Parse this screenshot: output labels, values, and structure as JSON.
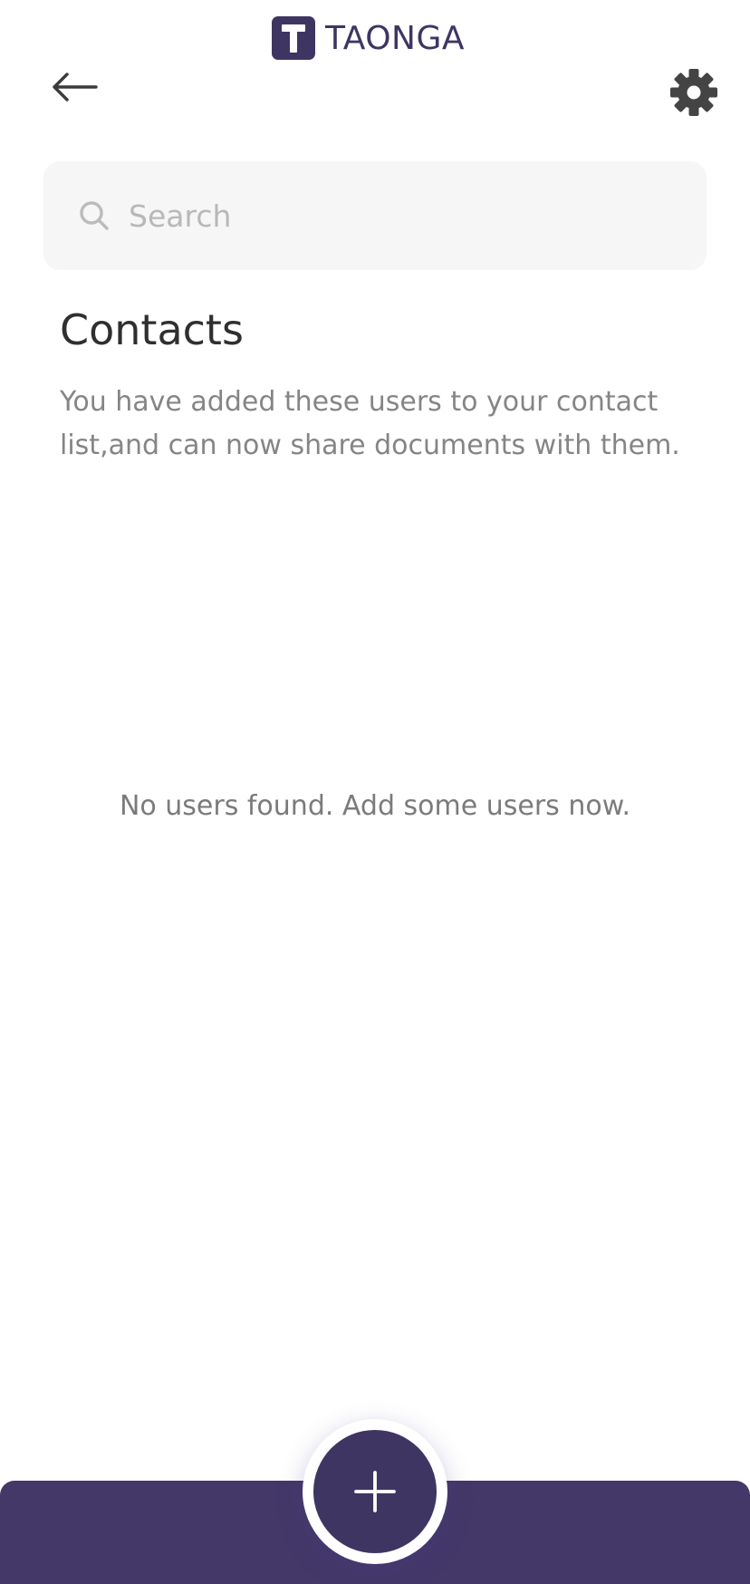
{
  "app": {
    "brand_name": "TAONGA",
    "brand_color": "#3f3563",
    "bottom_bar_color": "#433868"
  },
  "header": {
    "back_icon": "arrow-left-icon",
    "settings_icon": "gear-icon"
  },
  "search": {
    "placeholder": "Search",
    "value": "",
    "icon": "search-icon"
  },
  "main": {
    "title": "Contacts",
    "description": "You have added these users to your contact list,and can now share documents with them.",
    "empty_message": "No users found. Add some users now."
  },
  "fab": {
    "icon": "plus-icon"
  }
}
